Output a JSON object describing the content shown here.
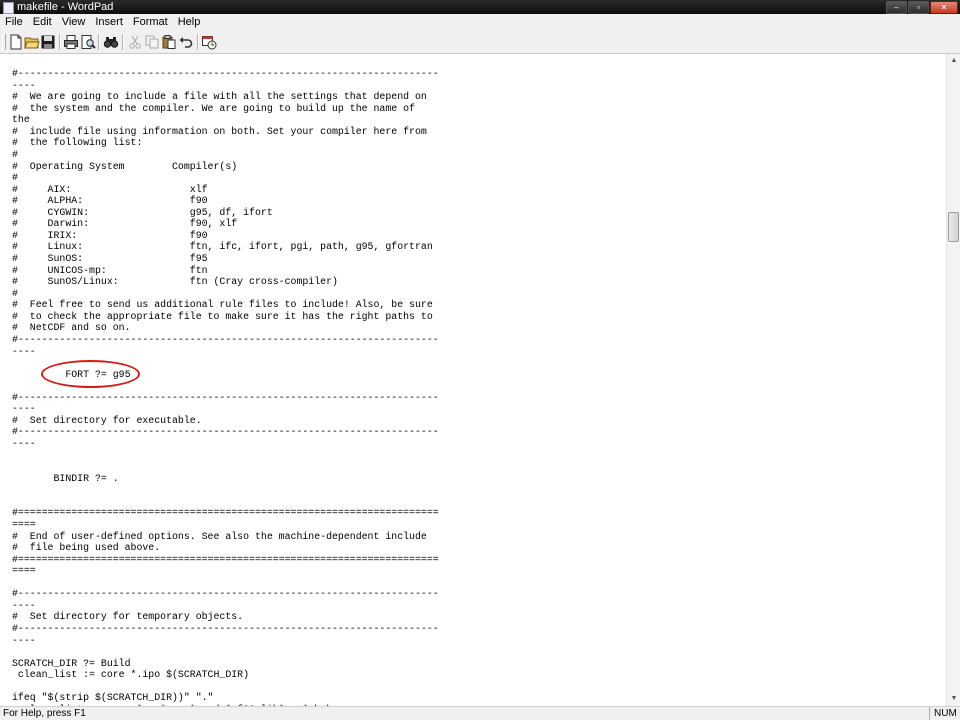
{
  "window": {
    "title": "makefile - WordPad",
    "buttons": {
      "minimize": "–",
      "restore": "▫",
      "close": "✕"
    }
  },
  "menu": [
    {
      "label": "File"
    },
    {
      "label": "Edit"
    },
    {
      "label": "View"
    },
    {
      "label": "Insert"
    },
    {
      "label": "Format"
    },
    {
      "label": "Help"
    }
  ],
  "toolbar": {
    "icons": [
      "new-document-icon",
      "open-folder-icon",
      "save-icon",
      "print-icon",
      "print-preview-icon",
      "find-icon",
      "cut-icon",
      "copy-icon",
      "paste-icon",
      "undo-icon",
      "insert-datetime-icon"
    ]
  },
  "document": {
    "content": "#-----------------------------------------------------------------------\n----\n#  We are going to include a file with all the settings that depend on\n#  the system and the compiler. We are going to build up the name of\nthe\n#  include file using information on both. Set your compiler here from\n#  the following list:\n#\n#  Operating System        Compiler(s)\n#\n#     AIX:                    xlf\n#     ALPHA:                  f90\n#     CYGWIN:                 g95, df, ifort\n#     Darwin:                 f90, xlf\n#     IRIX:                   f90\n#     Linux:                  ftn, ifc, ifort, pgi, path, g95, gfortran\n#     SunOS:                  f95\n#     UNICOS-mp:              ftn\n#     SunOS/Linux:            ftn (Cray cross-compiler)\n#\n#  Feel free to send us additional rule files to include! Also, be sure\n#  to check the appropriate file to make sure it has the right paths to\n#  NetCDF and so on.\n#-----------------------------------------------------------------------\n----\n\n         FORT ?= g95\n\n#-----------------------------------------------------------------------\n----\n#  Set directory for executable.\n#-----------------------------------------------------------------------\n----\n\n\n       BINDIR ?= .\n\n\n#=======================================================================\n====\n#  End of user-defined options. See also the machine-dependent include\n#  file being used above.\n#=======================================================================\n====\n\n#-----------------------------------------------------------------------\n----\n#  Set directory for temporary objects.\n#-----------------------------------------------------------------------\n----\n\nSCRATCH_DIR ?= Build\n clean_list := core *.ipo $(SCRATCH_DIR)\n\nifeq \"$(strip $(SCRATCH_DIR))\" \".\"\n  clean_list := core *.o *.oo *.mod *.f90 lib*.a *.bak\n  clean_list += $(CURDIR)/*.ipo"
  },
  "annotation": {
    "color": "#d21b1b"
  },
  "status": {
    "help_text": "For Help, press F1",
    "num_indicator": "NUM"
  }
}
